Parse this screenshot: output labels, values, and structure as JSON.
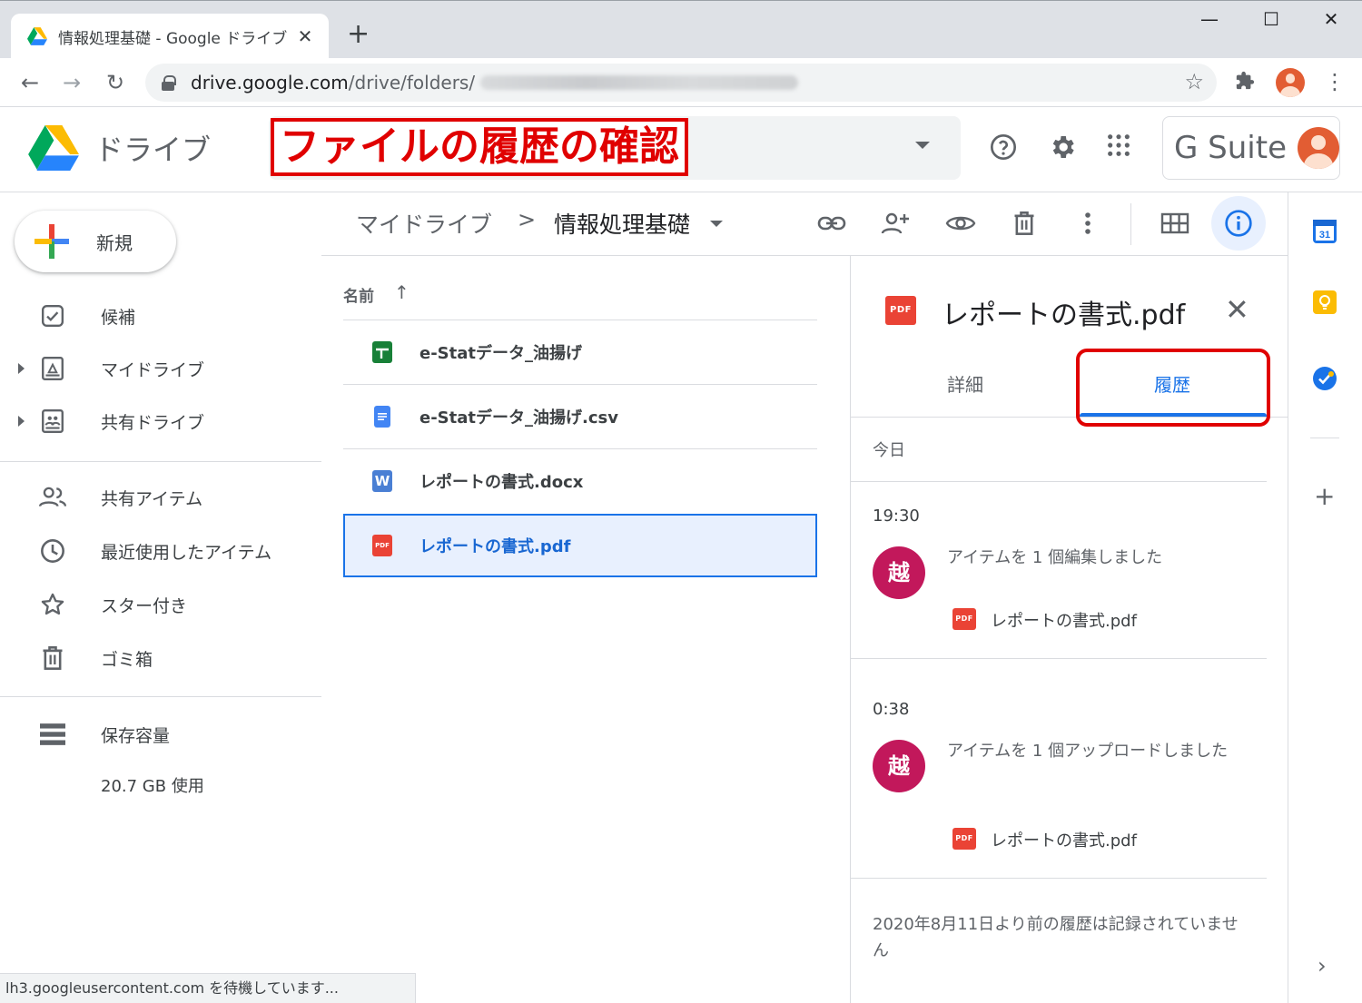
{
  "browser": {
    "tab_title": "情報処理基礎 - Google ドライブ",
    "url_host": "drive.google.com",
    "url_path": "/drive/folders/"
  },
  "header": {
    "brand": "ドライブ",
    "annotation": "ファイルの履歴の確認",
    "gsuite": "G Suite"
  },
  "sidebar": {
    "new_label": "新規",
    "items": [
      {
        "label": "候補",
        "icon": "checkbox-icon"
      },
      {
        "label": "マイドライブ",
        "icon": "my-drive-icon"
      },
      {
        "label": "共有ドライブ",
        "icon": "shared-drive-icon"
      },
      {
        "label": "共有アイテム",
        "icon": "people-icon"
      },
      {
        "label": "最近使用したアイテム",
        "icon": "clock-icon"
      },
      {
        "label": "スター付き",
        "icon": "star-icon"
      },
      {
        "label": "ゴミ箱",
        "icon": "trash-icon"
      },
      {
        "label": "保存容量",
        "icon": "storage-icon"
      }
    ],
    "storage_used": "20.7 GB 使用"
  },
  "breadcrumb": {
    "root": "マイドライブ",
    "separator": ">",
    "current": "情報処理基礎"
  },
  "files": {
    "column_name": "名前",
    "sort_arrow": "↑",
    "rows": [
      {
        "name": "e-Statデータ_油揚げ",
        "type": "sheets"
      },
      {
        "name": "e-Statデータ_油揚げ.csv",
        "type": "docs"
      },
      {
        "name": "レポートの書式.docx",
        "type": "word"
      },
      {
        "name": "レポートの書式.pdf",
        "type": "pdf",
        "selected": true
      }
    ]
  },
  "details": {
    "title": "レポートの書式.pdf",
    "pdf_badge": "PDF",
    "tab_details": "詳細",
    "tab_history": "履歴",
    "today": "今日",
    "activities": [
      {
        "time": "19:30",
        "avatar": "越",
        "desc": "アイテムを 1 個編集しました",
        "file": "レポートの書式.pdf"
      },
      {
        "time": "0:38",
        "avatar": "越",
        "desc": "アイテムを 1 個アップロードしました",
        "file": "レポートの書式.pdf"
      }
    ],
    "note": "2020年8月11日より前の履歴は記録されていません"
  },
  "statusbar": "lh3.googleusercontent.com を待機しています..."
}
